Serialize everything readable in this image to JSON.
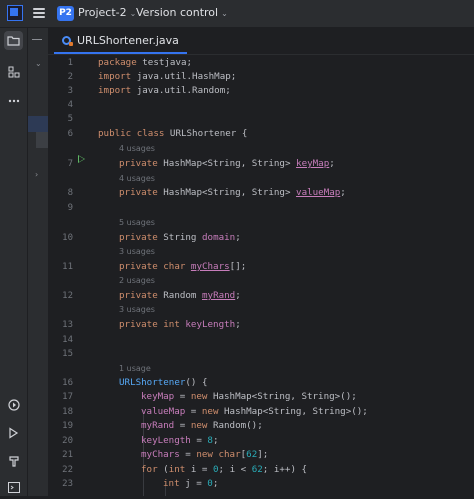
{
  "header": {
    "project_badge": "P2",
    "project_name": "Project-2",
    "vcs_label": "Version control"
  },
  "tab": {
    "label": "URLShortener.java"
  },
  "hints": {
    "h7": "4 usages",
    "h8": "4 usages",
    "h10": "5 usages",
    "h11": "3 usages",
    "h12": "2 usages",
    "h13": "3 usages",
    "h16": "1 usage"
  },
  "code": {
    "l1a": "package ",
    "l1b": "testjava;",
    "l2a": "import ",
    "l2b": "java.util.HashMap;",
    "l3a": "import ",
    "l3b": "java.util.Random;",
    "l6a": "public class ",
    "l6b": "URLShortener {",
    "l7a": "private ",
    "l7b": "HashMap<String, String> ",
    "l7c": "keyMap",
    "l7d": ";",
    "l8a": "private ",
    "l8b": "HashMap<String, String> ",
    "l8c": "valueMap",
    "l8d": ";",
    "l10a": "private ",
    "l10b": "String ",
    "l10c": "domain",
    "l10d": ";",
    "l11a": "private char ",
    "l11c": "myChars",
    "l11d": "[];",
    "l12a": "private ",
    "l12b": "Random ",
    "l12c": "myRand",
    "l12d": ";",
    "l13a": "private int ",
    "l13c": "keyLength",
    "l13d": ";",
    "l16a": "URLShortener",
    "l16b": "() {",
    "l17a": "keyMap",
    "l17b": " = ",
    "l17c": "new ",
    "l17d": "HashMap<String, String>();",
    "l18a": "valueMap",
    "l18b": " = ",
    "l18c": "new ",
    "l18d": "HashMap<String, String>();",
    "l19a": "myRand",
    "l19b": " = ",
    "l19c": "new ",
    "l19d": "Random();",
    "l20a": "keyLength",
    "l20b": " = ",
    "l20c": "8",
    "l20d": ";",
    "l21a": "myChars",
    "l21b": " = ",
    "l21c": "new char",
    "l21d": "[",
    "l21e": "62",
    "l21f": "];",
    "l22a": "for ",
    "l22b": "(",
    "l22c": "int ",
    "l22d": "i = ",
    "l22e": "0",
    "l22f": "; i < ",
    "l22g": "62",
    "l22h": "; i++) {",
    "l23a": "int ",
    "l23b": "j = ",
    "l23c": "0",
    "l23d": ";"
  },
  "line_numbers": [
    "1",
    "2",
    "3",
    "4",
    "5",
    "6",
    "7",
    "8",
    "9",
    "10",
    "11",
    "12",
    "13",
    "14",
    "15",
    "16",
    "17",
    "18",
    "19",
    "20",
    "21",
    "22",
    "23"
  ]
}
